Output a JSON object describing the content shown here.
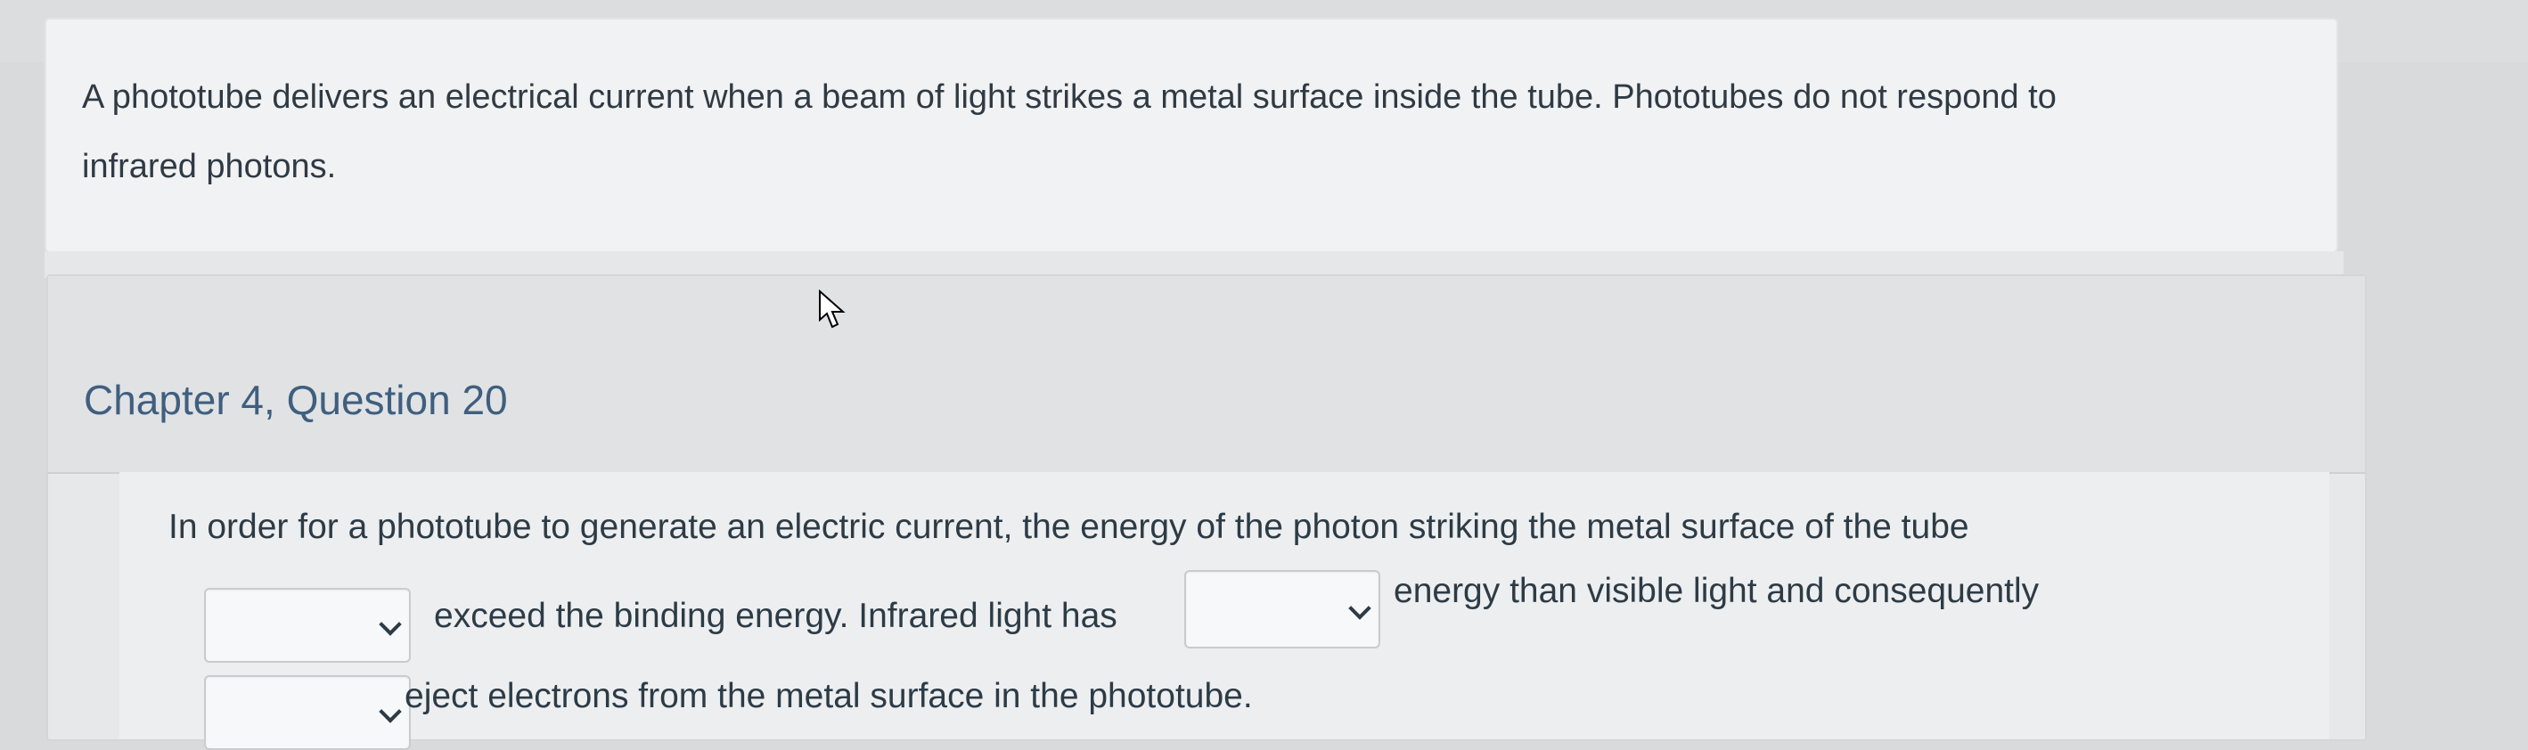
{
  "intro": {
    "text_line1": "A phototube delivers an electrical current when a beam of light strikes a metal surface inside the tube. Phototubes do not respond to",
    "text_line2": "infrared photons."
  },
  "question": {
    "title": "Chapter 4, Question 20",
    "line1": "In order for a phototube to generate an electric current, the energy of the photon striking the metal surface of the tube",
    "line2_part1": "exceed the binding energy. Infrared light has",
    "line2_part2": "energy than visible light and consequently",
    "line3": "eject electrons from the metal surface in the phototube.",
    "dropdowns": [
      {
        "selected": ""
      },
      {
        "selected": ""
      },
      {
        "selected": ""
      }
    ]
  }
}
